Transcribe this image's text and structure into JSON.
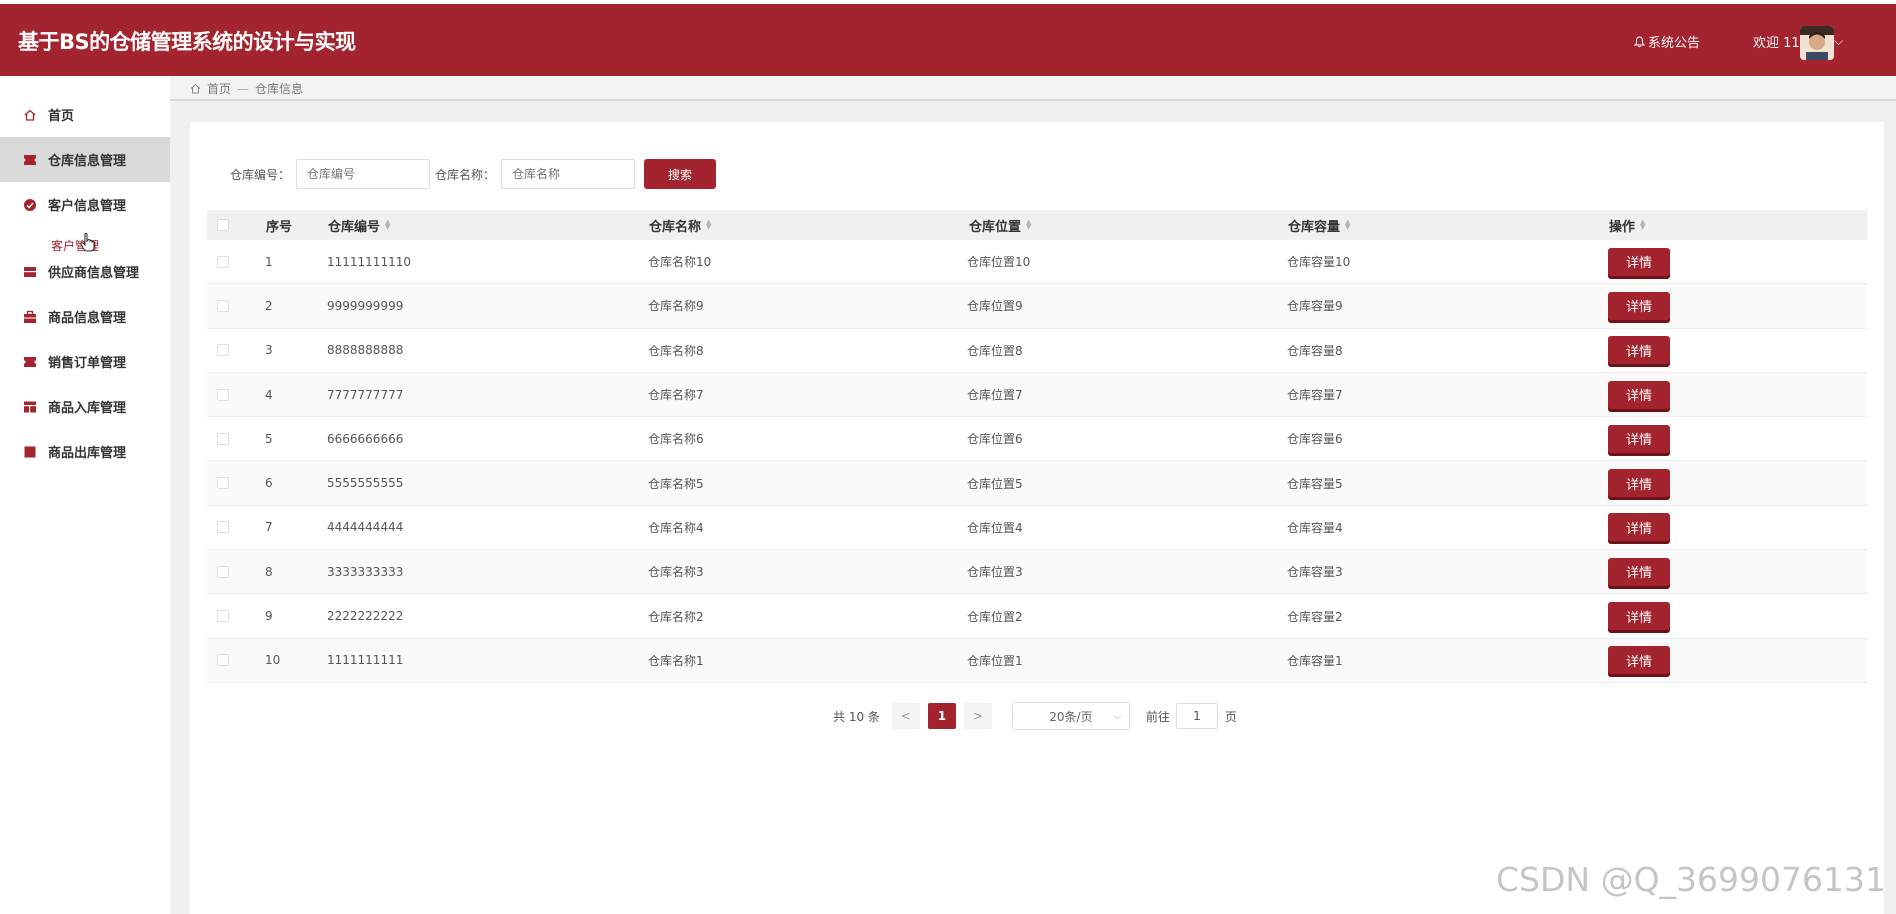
{
  "header": {
    "app_title": "基于BS的仓储管理系统的设计与实现",
    "notice_label": "系统公告",
    "welcome_label": "欢迎 11"
  },
  "sidebar": {
    "items": [
      {
        "label": "首页",
        "icon": "home-icon"
      },
      {
        "label": "仓库信息管理",
        "icon": "warehouse-icon"
      },
      {
        "label": "客户信息管理",
        "icon": "customer-icon"
      },
      {
        "label": "供应商信息管理",
        "icon": "supplier-icon"
      },
      {
        "label": "商品信息管理",
        "icon": "goods-icon"
      },
      {
        "label": "销售订单管理",
        "icon": "sales-order-icon"
      },
      {
        "label": "商品入库管理",
        "icon": "stock-in-icon"
      },
      {
        "label": "商品出库管理",
        "icon": "stock-out-icon"
      }
    ],
    "sub_item": "客户管理"
  },
  "breadcrumb": {
    "home": "首页",
    "separator": "—",
    "current": "仓库信息"
  },
  "search": {
    "code_label": "仓库编号：",
    "code_placeholder": "仓库编号",
    "name_label": "仓库名称：",
    "name_placeholder": "仓库名称",
    "button": "搜索"
  },
  "table": {
    "headers": {
      "index": "序号",
      "code": "仓库编号",
      "name": "仓库名称",
      "location": "仓库位置",
      "capacity": "仓库容量",
      "action": "操作"
    },
    "action_label": "详情",
    "rows": [
      {
        "index": "1",
        "code": "11111111110",
        "name": "仓库名称10",
        "location": "仓库位置10",
        "capacity": "仓库容量10"
      },
      {
        "index": "2",
        "code": "9999999999",
        "name": "仓库名称9",
        "location": "仓库位置9",
        "capacity": "仓库容量9"
      },
      {
        "index": "3",
        "code": "8888888888",
        "name": "仓库名称8",
        "location": "仓库位置8",
        "capacity": "仓库容量8"
      },
      {
        "index": "4",
        "code": "7777777777",
        "name": "仓库名称7",
        "location": "仓库位置7",
        "capacity": "仓库容量7"
      },
      {
        "index": "5",
        "code": "6666666666",
        "name": "仓库名称6",
        "location": "仓库位置6",
        "capacity": "仓库容量6"
      },
      {
        "index": "6",
        "code": "5555555555",
        "name": "仓库名称5",
        "location": "仓库位置5",
        "capacity": "仓库容量5"
      },
      {
        "index": "7",
        "code": "4444444444",
        "name": "仓库名称4",
        "location": "仓库位置4",
        "capacity": "仓库容量4"
      },
      {
        "index": "8",
        "code": "3333333333",
        "name": "仓库名称3",
        "location": "仓库位置3",
        "capacity": "仓库容量3"
      },
      {
        "index": "9",
        "code": "2222222222",
        "name": "仓库名称2",
        "location": "仓库位置2",
        "capacity": "仓库容量2"
      },
      {
        "index": "10",
        "code": "1111111111",
        "name": "仓库名称1",
        "location": "仓库位置1",
        "capacity": "仓库容量1"
      }
    ]
  },
  "pagination": {
    "total": "共 10 条",
    "prev": "<",
    "current_page": "1",
    "next": ">",
    "page_size": "20条/页",
    "goto_label": "前往",
    "goto_value": "1",
    "page_unit": "页"
  },
  "watermark": "CSDN @Q_3699076131",
  "colors": {
    "brand": "#a3232e",
    "brand_dark": "#6f1118",
    "sidebar_active": "#d9d9d9"
  }
}
